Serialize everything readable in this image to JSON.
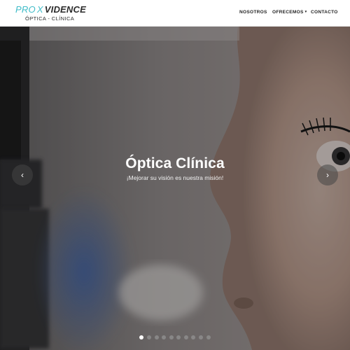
{
  "brand": {
    "name_part1": "PRO",
    "name_x": "X",
    "name_part2": "VIDENCE",
    "tagline": "ÓPTICA - CLÍNICA",
    "accent_color": "#3fbcc8"
  },
  "nav": {
    "items": [
      {
        "label": "NOSOTROS"
      },
      {
        "label": "OFRECEMOS",
        "caret": "▾"
      },
      {
        "label": "CONTACTO"
      }
    ]
  },
  "hero": {
    "title": "Óptica Clínica",
    "subtitle": "¡Mejorar su visión es nuestra misión!",
    "prev_icon": "‹",
    "next_icon": "›",
    "slide_count": 10,
    "active_slide": 1
  }
}
